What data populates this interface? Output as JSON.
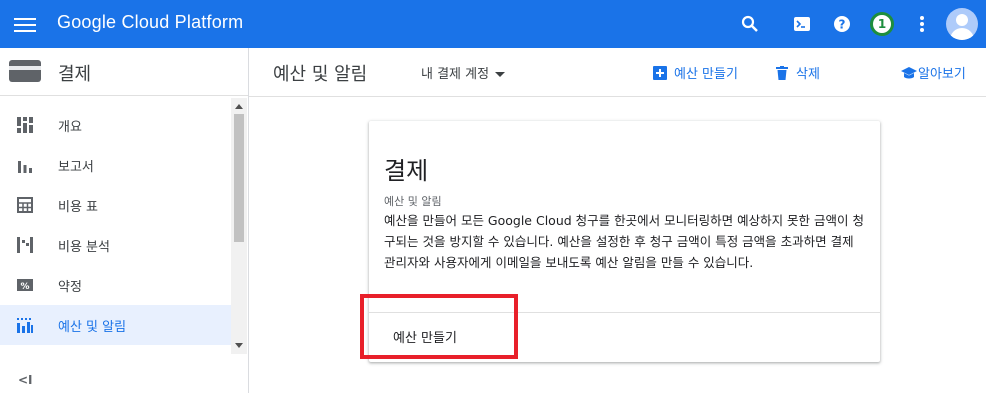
{
  "topbar": {
    "brand": "Google Cloud Platform",
    "notification_count": "1",
    "icons": [
      "menu-icon",
      "search-icon",
      "cloud-shell-icon",
      "help-icon",
      "notification-badge",
      "more-vert-icon",
      "avatar"
    ],
    "color": "#1a73e8"
  },
  "sidebar": {
    "title": "결제",
    "items": [
      {
        "label": "개요",
        "icon": "dashboard-icon"
      },
      {
        "label": "보고서",
        "icon": "bar-chart-icon"
      },
      {
        "label": "비용 표",
        "icon": "table-icon"
      },
      {
        "label": "비용 분석",
        "icon": "cost-breakdown-icon"
      },
      {
        "label": "약정",
        "icon": "percent-icon"
      },
      {
        "label": "예산 및 알림",
        "icon": "budget-icon",
        "active": true
      }
    ],
    "collapse_label": "<I"
  },
  "header": {
    "title": "예산 및 알림",
    "account_select": "내 결제 계정",
    "create_label": "예산 만들기",
    "delete_label": "삭제",
    "learn_label": "알아보기"
  },
  "card": {
    "title": "결제",
    "subtitle": "예산 및 알림",
    "body": "예산을 만들어 모든 Google Cloud 청구를 한곳에서 모니터링하면 예상하지 못한 금액이 청구되는 것을 방지할 수 있습니다. 예산을 설정한 후 청구 금액이 특정 금액을 초과하면 결제 관리자와 사용자에게 이메일을 보내도록 예산 알림을 만들 수 있습니다.",
    "button_label": "예산 만들기"
  },
  "colors": {
    "accent": "#1a73e8",
    "highlight": "#e8202a",
    "active_bg": "#e8f0fe"
  }
}
